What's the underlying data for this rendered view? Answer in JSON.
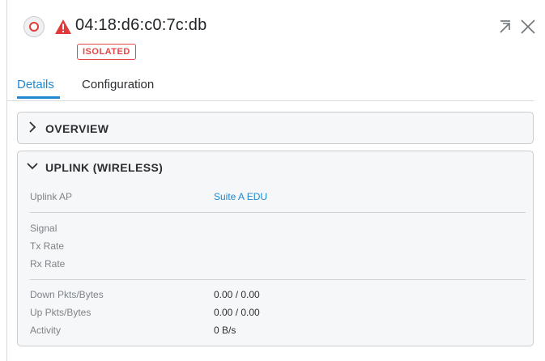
{
  "header": {
    "device_name": "04:18:d6:c0:7c:db",
    "status_badge": "ISOLATED",
    "icons": {
      "device": "device-status-icon",
      "warning": "warning-triangle-icon",
      "popout": "popout-arrow-icon",
      "close": "close-icon"
    },
    "colors": {
      "alert_red": "#e04848",
      "accent_blue": "#1f8ad1"
    }
  },
  "tabs": [
    {
      "label": "Details",
      "active": true
    },
    {
      "label": "Configuration",
      "active": false
    }
  ],
  "sections": {
    "overview": {
      "title": "OVERVIEW",
      "expanded": false
    },
    "uplink": {
      "title": "UPLINK (WIRELESS)",
      "expanded": true,
      "uplink_ap_label": "Uplink AP",
      "uplink_ap_value": "Suite A EDU",
      "signal_label": "Signal",
      "tx_rate_label": "Tx Rate",
      "rx_rate_label": "Rx Rate",
      "down_label": "Down Pkts/Bytes",
      "down_value": "0.00 / 0.00",
      "up_label": "Up Pkts/Bytes",
      "up_value": "0.00 / 0.00",
      "activity_label": "Activity",
      "activity_value": "0 B/s"
    }
  }
}
